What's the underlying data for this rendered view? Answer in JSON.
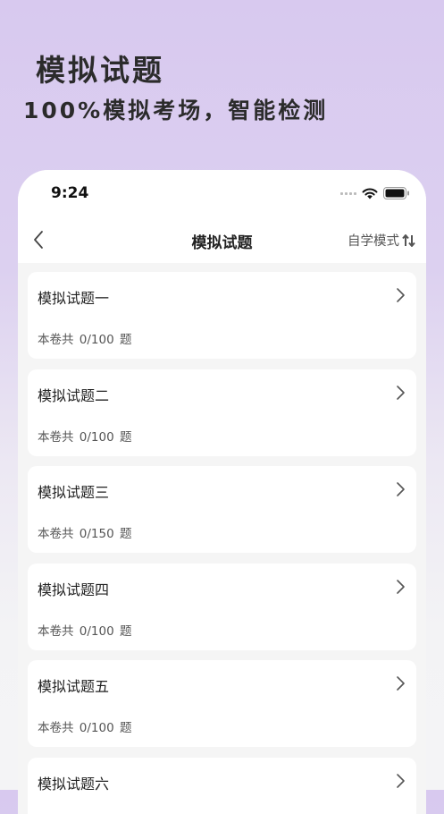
{
  "promo": {
    "title": "模拟试题",
    "subtitle": "100%模拟考场，智能检测"
  },
  "status_bar": {
    "time": "9:24",
    "icons": [
      "signal-icon",
      "wifi-icon",
      "battery-icon"
    ]
  },
  "nav": {
    "back_icon": "chevron-left-icon",
    "title": "模拟试题",
    "mode_label": "自学模式",
    "mode_icon": "sort-arrows-icon"
  },
  "exams": [
    {
      "title": "模拟试题一",
      "count": "本卷共 0/100 题"
    },
    {
      "title": "模拟试题二",
      "count": "本卷共 0/100 题"
    },
    {
      "title": "模拟试题三",
      "count": "本卷共 0/150 题"
    },
    {
      "title": "模拟试题四",
      "count": "本卷共 0/100 题"
    },
    {
      "title": "模拟试题五",
      "count": "本卷共 0/100 题"
    },
    {
      "title": "模拟试题六",
      "count": ""
    }
  ],
  "colors": {
    "promo_background": "#d8c9ef",
    "card_background": "#ffffff",
    "page_background": "#f5f5f5",
    "text_primary": "#222222",
    "text_secondary": "#555555"
  }
}
